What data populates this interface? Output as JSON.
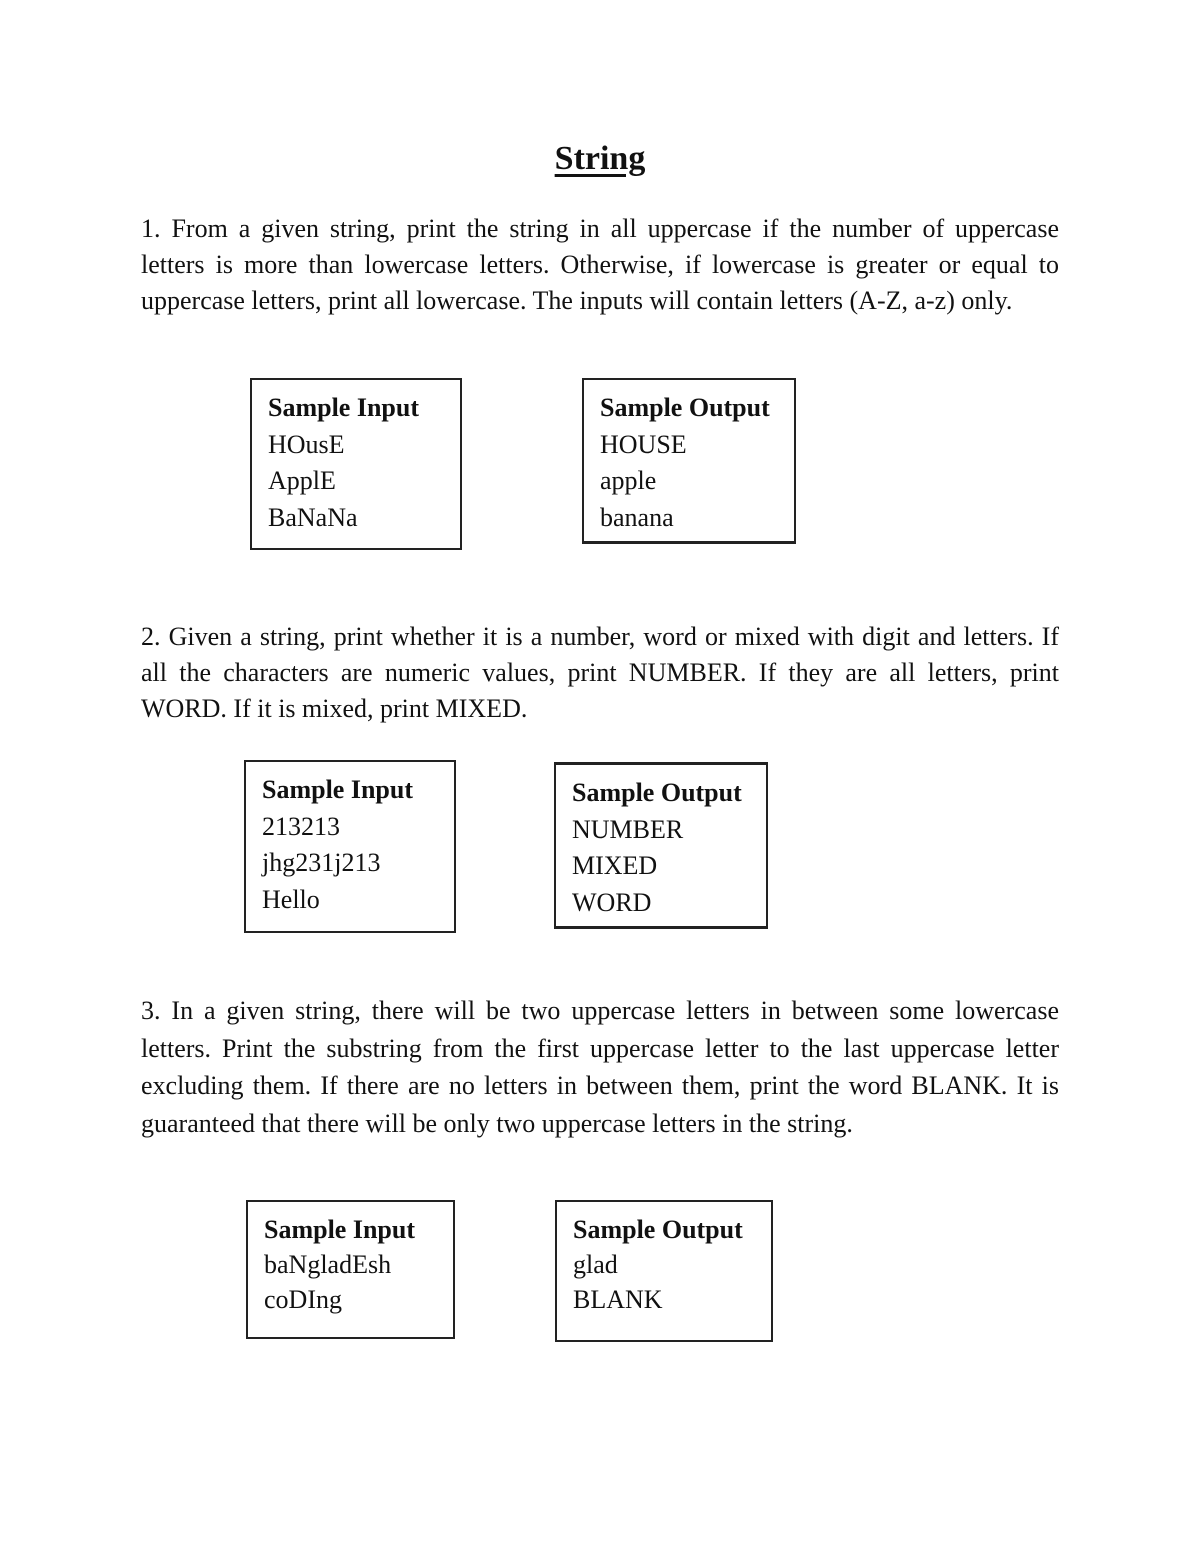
{
  "title": "String",
  "problems": [
    {
      "text": "1. From a given string, print the string in all uppercase if the number of uppercase letters is more than lowercase letters. Otherwise, if lowercase is greater or equal to uppercase letters, print all lowercase. The inputs will contain letters (A-Z, a-z) only.",
      "input_header": "Sample Input",
      "inputs": [
        "HOusE",
        "ApplE",
        "BaNaNa"
      ],
      "output_header": "Sample Output",
      "outputs": [
        "HOUSE",
        "apple",
        "banana"
      ]
    },
    {
      "text": "2. Given a string, print whether it is a number, word or mixed with digit and letters. If all the characters are numeric values, print NUMBER. If they are all letters, print WORD. If it is mixed, print MIXED.",
      "input_header": "Sample Input",
      "inputs": [
        "213213",
        "jhg231j213",
        "Hello"
      ],
      "output_header": "Sample Output",
      "outputs": [
        "NUMBER",
        "MIXED",
        "WORD"
      ]
    },
    {
      "text": "3. In a given string, there will be two uppercase letters in between some lowercase letters. Print the substring from the first uppercase letter to the last uppercase letter excluding them. If there are no letters in between them, print the word BLANK. It is guaranteed that there will be only two uppercase letters in the string.",
      "input_header": "Sample Input",
      "inputs": [
        "baNgladEsh",
        "coDIng"
      ],
      "output_header": "Sample Output",
      "outputs": [
        "glad",
        "BLANK"
      ]
    }
  ]
}
